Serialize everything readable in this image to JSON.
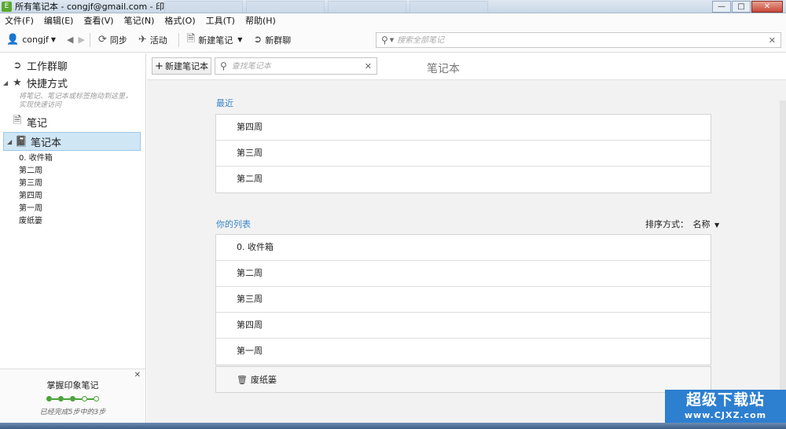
{
  "window": {
    "title": "所有笔记本 - congjf@gmail.com - 印象笔记",
    "app_icon": "E",
    "minimize": "—",
    "maximize": "□",
    "close": "✕"
  },
  "menu": [
    "文件(F)",
    "编辑(E)",
    "查看(V)",
    "笔记(N)",
    "格式(O)",
    "工具(T)",
    "帮助(H)"
  ],
  "toolbar": {
    "user": "congjf",
    "sync": "同步",
    "activity": "活动",
    "new_note": "新建笔记",
    "new_chat": "新群聊",
    "search_placeholder": "搜索全部笔记"
  },
  "sidebar": {
    "work_chat": "工作群聊",
    "shortcuts": "快捷方式",
    "shortcuts_hint": "将笔记、笔记本或标签拖动到这里，实现快速访问",
    "notes": "笔记",
    "notebooks": "笔记本",
    "notebook_list": [
      "0. 收件箱",
      "第二周",
      "第三周",
      "第四周",
      "第一周",
      "废纸篓"
    ],
    "promo": {
      "title": "掌握印象笔记",
      "subtitle": "已经完成5步中的3步",
      "completed_steps": 3,
      "total_steps": 5
    }
  },
  "main": {
    "new_notebook_button": "新建笔记本",
    "search_placeholder": "查找笔记本",
    "title": "笔记本",
    "recent_label": "最近",
    "recent": [
      "第四周",
      "第三周",
      "第二周"
    ],
    "your_list_label": "你的列表",
    "sort_label": "排序方式：",
    "sort_value": "名称",
    "your_list": [
      "0. 收件箱",
      "第二周",
      "第三周",
      "第四周",
      "第一周"
    ],
    "trash": "废纸篓"
  },
  "watermark": {
    "big": "超级下载站",
    "small": "www.CJXZ.com"
  },
  "colors": {
    "accent": "#3a86c8",
    "selected_bg": "#cfe6f5",
    "progress_green": "#4aa339"
  }
}
